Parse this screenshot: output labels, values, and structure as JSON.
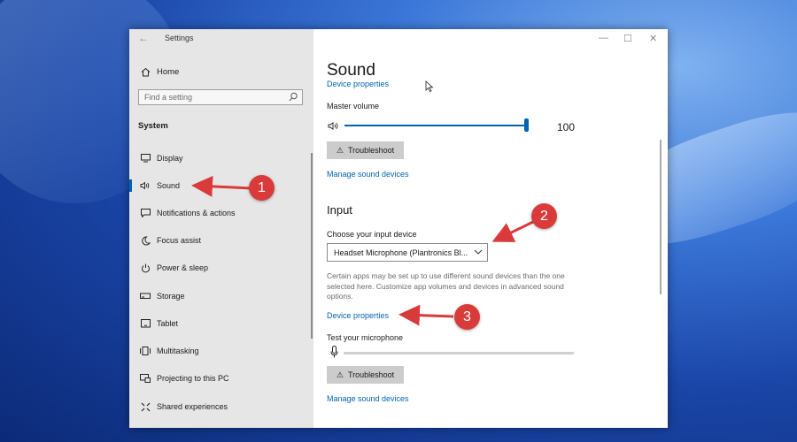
{
  "window": {
    "app_title": "Settings",
    "controls": {
      "minimize": "—",
      "maximize": "☐",
      "close": "✕"
    }
  },
  "sidebar": {
    "home": {
      "label": "Home",
      "icon": "home-icon"
    },
    "search": {
      "placeholder": "Find a setting"
    },
    "section": "System",
    "items": [
      {
        "label": "Display",
        "icon": "display-icon"
      },
      {
        "label": "Sound",
        "icon": "speaker-icon",
        "active": true
      },
      {
        "label": "Notifications & actions",
        "icon": "notifications-icon"
      },
      {
        "label": "Focus assist",
        "icon": "moon-icon"
      },
      {
        "label": "Power & sleep",
        "icon": "power-icon"
      },
      {
        "label": "Storage",
        "icon": "storage-icon"
      },
      {
        "label": "Tablet",
        "icon": "tablet-icon"
      },
      {
        "label": "Multitasking",
        "icon": "multitasking-icon"
      },
      {
        "label": "Projecting to this PC",
        "icon": "projecting-icon"
      },
      {
        "label": "Shared experiences",
        "icon": "shared-icon"
      }
    ]
  },
  "content": {
    "title": "Sound",
    "output": {
      "device_properties_link": "Device properties",
      "master_volume_label": "Master volume",
      "master_volume_value": "100",
      "troubleshoot_label": "Troubleshoot",
      "manage_devices_link": "Manage sound devices"
    },
    "input": {
      "heading": "Input",
      "choose_label": "Choose your input device",
      "selected_device": "Headset Microphone (Plantronics Bl...",
      "note": "Certain apps may be set up to use different sound devices than the one selected here. Customize app volumes and devices in advanced sound options.",
      "device_properties_link": "Device properties",
      "test_mic_label": "Test your microphone",
      "mic_level": 0,
      "troubleshoot_label": "Troubleshoot",
      "manage_devices_link": "Manage sound devices"
    }
  },
  "annotations": [
    "1",
    "2",
    "3"
  ],
  "colors": {
    "accent": "#0063b1",
    "annotation": "#d93b3b",
    "sidebar_bg": "#e6e6e6"
  }
}
